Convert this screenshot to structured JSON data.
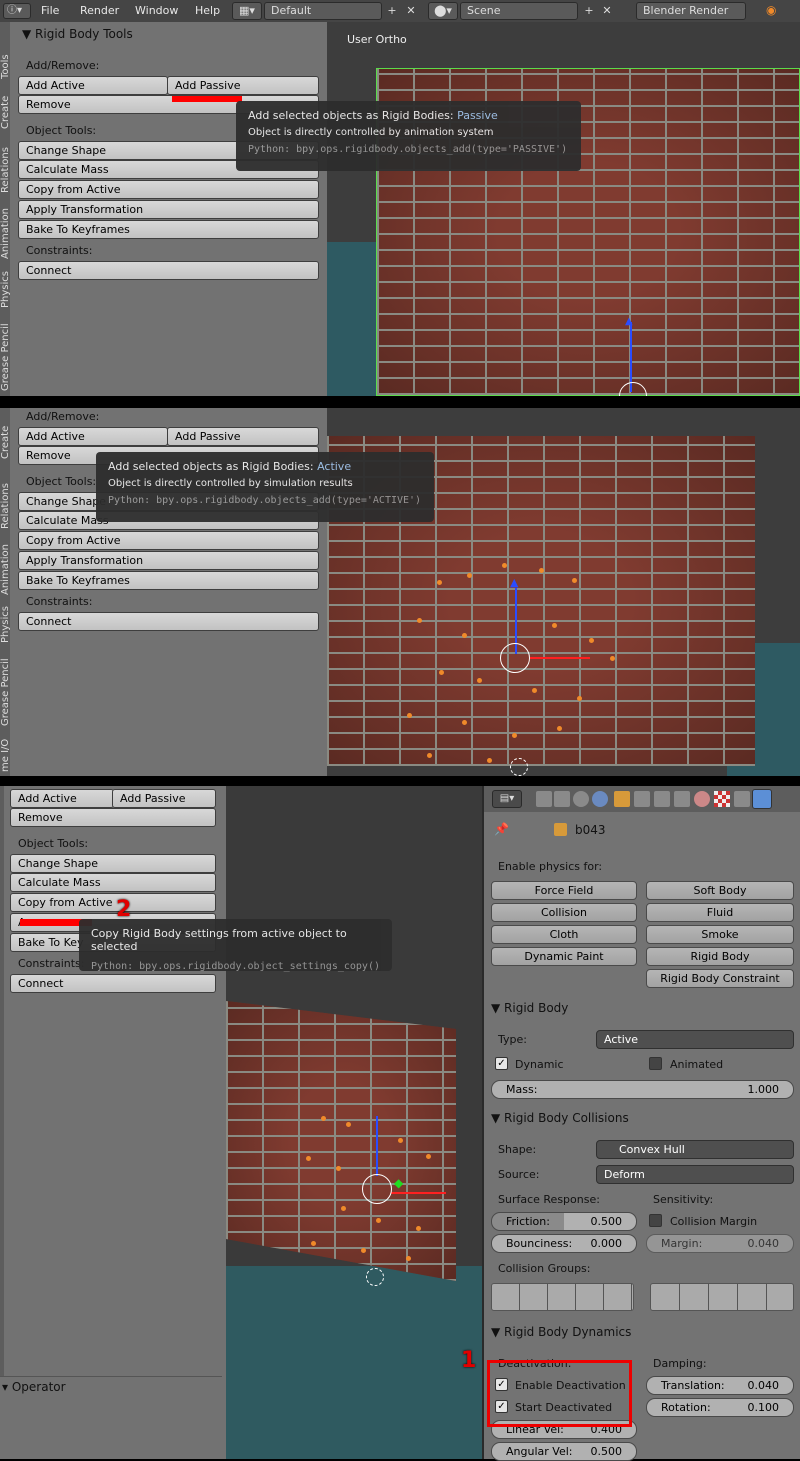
{
  "topbar": {
    "menus": [
      "File",
      "Render",
      "Window",
      "Help"
    ],
    "layout": "Default",
    "scene": "Scene",
    "engine": "Blender Render"
  },
  "tools": {
    "panel_title": "Rigid Body Tools",
    "add_remove": "Add/Remove:",
    "add_active": "Add Active",
    "add_passive": "Add Passive",
    "remove": "Remove",
    "object_tools": "Object Tools:",
    "change_shape": "Change Shape",
    "calc_mass": "Calculate Mass",
    "copy_active": "Copy from Active",
    "apply_transform": "Apply Transformation",
    "bake": "Bake To Keyframes",
    "constraints": "Constraints:",
    "connect": "Connect",
    "change_shape_cut": "Change Shape",
    "calc_mass_cut": "Calculate Mass",
    "apply_cut": "A",
    "bake_cut": "Bake To Key",
    "tabs": [
      "Tools",
      "Create",
      "Relations",
      "Animation",
      "Physics",
      "Grease Pencil"
    ],
    "tabs2": [
      "Create",
      "Relations",
      "Animation",
      "Physics",
      "Grease Pencil",
      "me I/O"
    ]
  },
  "viewport": {
    "label": "User Ortho"
  },
  "tooltip1": {
    "title": "Add selected objects as Rigid Bodies:",
    "type": "Passive",
    "desc": "Object is directly controlled by animation system",
    "python": "Python: bpy.ops.rigidbody.objects_add(type='PASSIVE')"
  },
  "tooltip2": {
    "title": "Add selected objects as Rigid Bodies:",
    "type": "Active",
    "desc": "Object is directly controlled by simulation results",
    "python": "Python: bpy.ops.rigidbody.objects_add(type='ACTIVE')"
  },
  "tooltip3": {
    "title": "Copy Rigid Body settings from active object to selected",
    "python": "Python: bpy.ops.rigidbody.object_settings_copy()"
  },
  "operator": "Operator",
  "annotations": {
    "one": "1",
    "two": "2"
  },
  "props": {
    "object_name": "b043",
    "enable_physics": "Enable physics for:",
    "buttons": [
      "Force Field",
      "Soft Body",
      "Collision",
      "Fluid",
      "Cloth",
      "Smoke",
      "Dynamic Paint",
      "Rigid Body",
      "Rigid Body Constraint"
    ],
    "rigid_body": {
      "title": "Rigid Body",
      "type_label": "Type:",
      "type": "Active",
      "dynamic": "Dynamic",
      "animated": "Animated",
      "mass_label": "Mass:",
      "mass": "1.000"
    },
    "collisions": {
      "title": "Rigid Body Collisions",
      "shape_label": "Shape:",
      "shape": "Convex Hull",
      "source_label": "Source:",
      "source": "Deform",
      "surface": "Surface Response:",
      "sensitivity": "Sensitivity:",
      "friction_label": "Friction:",
      "friction": "0.500",
      "bounciness_label": "Bounciness:",
      "bounciness": "0.000",
      "collision_margin": "Collision Margin",
      "margin_label": "Margin:",
      "margin": "0.040",
      "groups": "Collision Groups:"
    },
    "dynamics": {
      "title": "Rigid Body Dynamics",
      "deactivation": "Deactivation:",
      "damping": "Damping:",
      "enable_deact": "Enable Deactivation",
      "start_deact": "Start Deactivated",
      "translation_label": "Translation:",
      "translation": "0.040",
      "rotation_label": "Rotation:",
      "rotation": "0.100",
      "linear_label": "Linear Vel:",
      "linear": "0.400",
      "angular_label": "Angular Vel:",
      "angular": "0.500"
    }
  }
}
